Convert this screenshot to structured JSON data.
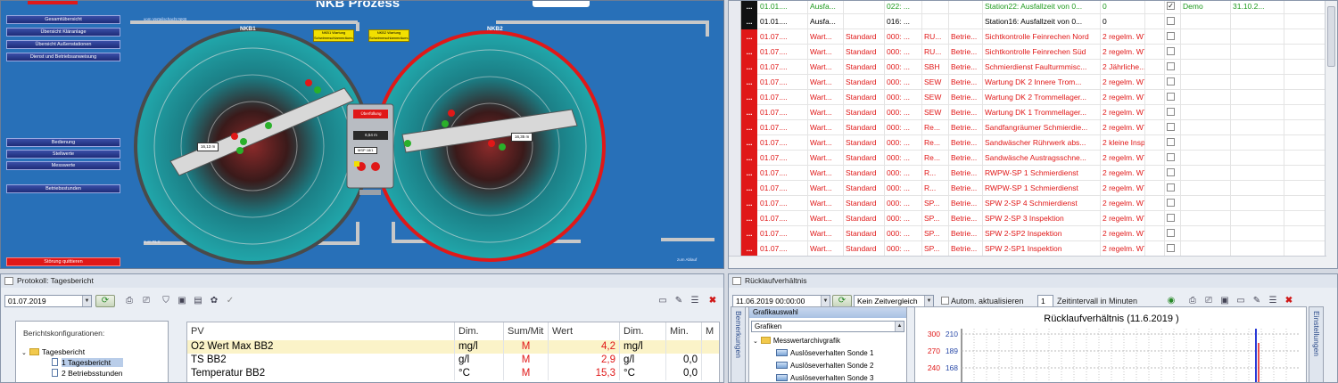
{
  "process": {
    "title": "NKB Prozess",
    "nav_buttons": [
      "Gesamtübersicht",
      "Übersicht Kläranlage",
      "Übersicht Außenstationen",
      "Dienst und Betriebsanweisung"
    ],
    "nav_buttons_2": [
      "Bedienung",
      "Stellwerte",
      "Messwerte"
    ],
    "nav_button_hours": "Betriebsstunden",
    "fault_button": "Störung quittieren",
    "labels": {
      "pipe_top": "vom Verteilschacht NKB",
      "basin_left": "NKB1",
      "basin_right": "NKB2",
      "pipe_bottom": "zum RLS",
      "pipe_right": "zum Ablauf",
      "warning_left": "NKB1 Wartung Schwimmschlammräumung",
      "warning_right": "NKB2 Wartung Schwimmschlammräumung",
      "value_left": "16,13 m",
      "value_right": "16,35 m",
      "center_label": "Überfüllung",
      "center_value": "6,54 m",
      "center_small": "MSP 18/1"
    },
    "colors": {
      "background": "#2870b8",
      "basin": "#1fa0a4",
      "alarm": "#e01818"
    }
  },
  "tasks": {
    "rows": [
      {
        "mark": "...",
        "date": "01.01....",
        "type": "Ausfa...",
        "std": "",
        "num": "022: ...",
        "o1": "",
        "o2": "",
        "desc": "Station22: Ausfallzeit von 0...",
        "int": "0",
        "checked": true,
        "user": "Demo",
        "dt": "31.10.2...",
        "color": "green",
        "mark_color": "black"
      },
      {
        "mark": "...",
        "date": "01.01....",
        "type": "Ausfa...",
        "std": "",
        "num": "016: ...",
        "o1": "",
        "o2": "",
        "desc": "Station16: Ausfallzeit von 0...",
        "int": "0",
        "checked": false,
        "user": "",
        "dt": "",
        "color": "black",
        "mark_color": "black"
      },
      {
        "mark": "...",
        "date": "01.07....",
        "type": "Wart...",
        "std": "Standard",
        "num": "000: ...",
        "o1": "RU...",
        "o2": "Betrie...",
        "desc": "Sichtkontrolle Feinrechen Nord",
        "int": "2 regelm. WT",
        "checked": false,
        "user": "",
        "dt": "",
        "color": "red",
        "mark_color": "red"
      },
      {
        "mark": "...",
        "date": "01.07....",
        "type": "Wart...",
        "std": "Standard",
        "num": "000: ...",
        "o1": "RU...",
        "o2": "Betrie...",
        "desc": "Sichtkontrolle Feinrechen Süd",
        "int": "2 regelm. WT",
        "checked": false,
        "user": "",
        "dt": "",
        "color": "red",
        "mark_color": "red"
      },
      {
        "mark": "...",
        "date": "01.07....",
        "type": "Wart...",
        "std": "Standard",
        "num": "000: ...",
        "o1": "SBH",
        "o2": "Betrie...",
        "desc": "Schmierdienst Faulturmmisc...",
        "int": "2 Jährliche...",
        "checked": false,
        "user": "",
        "dt": "",
        "color": "red",
        "mark_color": "red"
      },
      {
        "mark": "...",
        "date": "01.07....",
        "type": "Wart...",
        "std": "Standard",
        "num": "000: ...",
        "o1": "SEW",
        "o2": "Betrie...",
        "desc": "Wartung DK 2 Innere Trom...",
        "int": "2 regelm. WT",
        "checked": false,
        "user": "",
        "dt": "",
        "color": "red",
        "mark_color": "red"
      },
      {
        "mark": "...",
        "date": "01.07....",
        "type": "Wart...",
        "std": "Standard",
        "num": "000: ...",
        "o1": "SEW",
        "o2": "Betrie...",
        "desc": "Wartung DK 2 Trommellager...",
        "int": "2 regelm. WT",
        "checked": false,
        "user": "",
        "dt": "",
        "color": "red",
        "mark_color": "red"
      },
      {
        "mark": "...",
        "date": "01.07....",
        "type": "Wart...",
        "std": "Standard",
        "num": "000: ...",
        "o1": "SEW",
        "o2": "Betrie...",
        "desc": "Wartung DK 1 Trommellager...",
        "int": "2 regelm. WT",
        "checked": false,
        "user": "",
        "dt": "",
        "color": "red",
        "mark_color": "red"
      },
      {
        "mark": "...",
        "date": "01.07....",
        "type": "Wart...",
        "std": "Standard",
        "num": "000: ...",
        "o1": "Re...",
        "o2": "Betrie...",
        "desc": "Sandfangräumer Schmierdie...",
        "int": "2 regelm. WT",
        "checked": false,
        "user": "",
        "dt": "",
        "color": "red",
        "mark_color": "red"
      },
      {
        "mark": "...",
        "date": "01.07....",
        "type": "Wart...",
        "std": "Standard",
        "num": "000: ...",
        "o1": "Re...",
        "o2": "Betrie...",
        "desc": "Sandwäscher Rührwerk abs...",
        "int": "2 kleine Insp.",
        "checked": false,
        "user": "",
        "dt": "",
        "color": "red",
        "mark_color": "red"
      },
      {
        "mark": "...",
        "date": "01.07....",
        "type": "Wart...",
        "std": "Standard",
        "num": "000: ...",
        "o1": "Re...",
        "o2": "Betrie...",
        "desc": "Sandwäsche Austragsschne...",
        "int": "2 regelm. WT",
        "checked": false,
        "user": "",
        "dt": "",
        "color": "red",
        "mark_color": "red"
      },
      {
        "mark": "...",
        "date": "01.07....",
        "type": "Wart...",
        "std": "Standard",
        "num": "000: ...",
        "o1": "R...",
        "o2": "Betrie...",
        "desc": "RWPW-SP 1 Schmierdienst",
        "int": "2 regelm. WT",
        "checked": false,
        "user": "",
        "dt": "",
        "color": "red",
        "mark_color": "red"
      },
      {
        "mark": "...",
        "date": "01.07....",
        "type": "Wart...",
        "std": "Standard",
        "num": "000: ...",
        "o1": "R...",
        "o2": "Betrie...",
        "desc": "RWPW-SP 1 Schmierdienst",
        "int": "2 regelm. WT",
        "checked": false,
        "user": "",
        "dt": "",
        "color": "red",
        "mark_color": "red"
      },
      {
        "mark": "...",
        "date": "01.07....",
        "type": "Wart...",
        "std": "Standard",
        "num": "000: ...",
        "o1": "SP...",
        "o2": "Betrie...",
        "desc": "SPW 2-SP 4 Schmierdienst",
        "int": "2 regelm. WT",
        "checked": false,
        "user": "",
        "dt": "",
        "color": "red",
        "mark_color": "red"
      },
      {
        "mark": "...",
        "date": "01.07....",
        "type": "Wart...",
        "std": "Standard",
        "num": "000: ...",
        "o1": "SP...",
        "o2": "Betrie...",
        "desc": "SPW 2-SP 3 Inspektion",
        "int": "2 regelm. WT",
        "checked": false,
        "user": "",
        "dt": "",
        "color": "red",
        "mark_color": "red"
      },
      {
        "mark": "...",
        "date": "01.07....",
        "type": "Wart...",
        "std": "Standard",
        "num": "000: ...",
        "o1": "SP...",
        "o2": "Betrie...",
        "desc": "SPW 2-SP2 Inspektion",
        "int": "2 regelm. WT",
        "checked": false,
        "user": "",
        "dt": "",
        "color": "red",
        "mark_color": "red"
      },
      {
        "mark": "...",
        "date": "01.07....",
        "type": "Wart...",
        "std": "Standard",
        "num": "000: ...",
        "o1": "SP...",
        "o2": "Betrie...",
        "desc": "SPW 2-SP1 Inspektion",
        "int": "2 regelm. WT",
        "checked": false,
        "user": "",
        "dt": "",
        "color": "red",
        "mark_color": "red"
      },
      {
        "mark": "...",
        "date": "01.07....",
        "type": "Wart...",
        "std": "Standard",
        "num": "000: ...",
        "o1": "SP...",
        "o2": "Betrie...",
        "desc": "SPW1-SP3-Schmierdienst",
        "int": "2 regelm. WT",
        "checked": false,
        "user": "",
        "dt": "",
        "color": "red",
        "mark_color": "red"
      }
    ]
  },
  "report": {
    "title": "Protokoll: Tagesbericht",
    "date": "01.07.2019",
    "config_label": "Berichtskonfigurationen:",
    "tree": {
      "root": "Tagesbericht",
      "items": [
        "1 Tagesbericht",
        "2 Betriebsstunden"
      ]
    },
    "columns": [
      "PV",
      "Dim.",
      "Sum/Mit",
      "Wert",
      "Dim.",
      "Min.",
      "M"
    ],
    "rows": [
      {
        "pv": "O2 Wert Max BB2",
        "dim": "mg/l",
        "sum": "M",
        "wert": "4,2",
        "dim2": "mg/l",
        "min": ""
      },
      {
        "pv": "TS BB2",
        "dim": "g/l",
        "sum": "M",
        "wert": "2,9",
        "dim2": "g/l",
        "min": "0,0"
      },
      {
        "pv": "Temperatur BB2",
        "dim": "°C",
        "sum": "M",
        "wert": "15,3",
        "dim2": "°C",
        "min": "0,0"
      }
    ]
  },
  "ratio": {
    "title": "Rücklaufverhältnis",
    "datetime": "11.06.2019 00:00:00",
    "compare": "Kein Zeitvergleich",
    "auto_update": "Autom. aktualisieren",
    "interval_value": "1",
    "interval_label": "Zeitintervall in Minuten",
    "side_left": "Bemerkungen",
    "side_right": "Einstellungen",
    "graph_select": {
      "header": "Grafikauswahl",
      "combo": "Grafiken",
      "group": "Messwertarchivgrafik",
      "items": [
        "Auslöseverhalten Sonde 1",
        "Auslöseverhalten Sonde 2",
        "Auslöseverhalten Sonde 3"
      ]
    },
    "chart_data": {
      "type": "line",
      "title": "Rücklaufverhältnis (11.6.2019 )",
      "y_left_ticks": [
        "300",
        "270",
        "240"
      ],
      "y_right_ticks": [
        "210",
        "189",
        "168"
      ],
      "grid": true
    }
  }
}
